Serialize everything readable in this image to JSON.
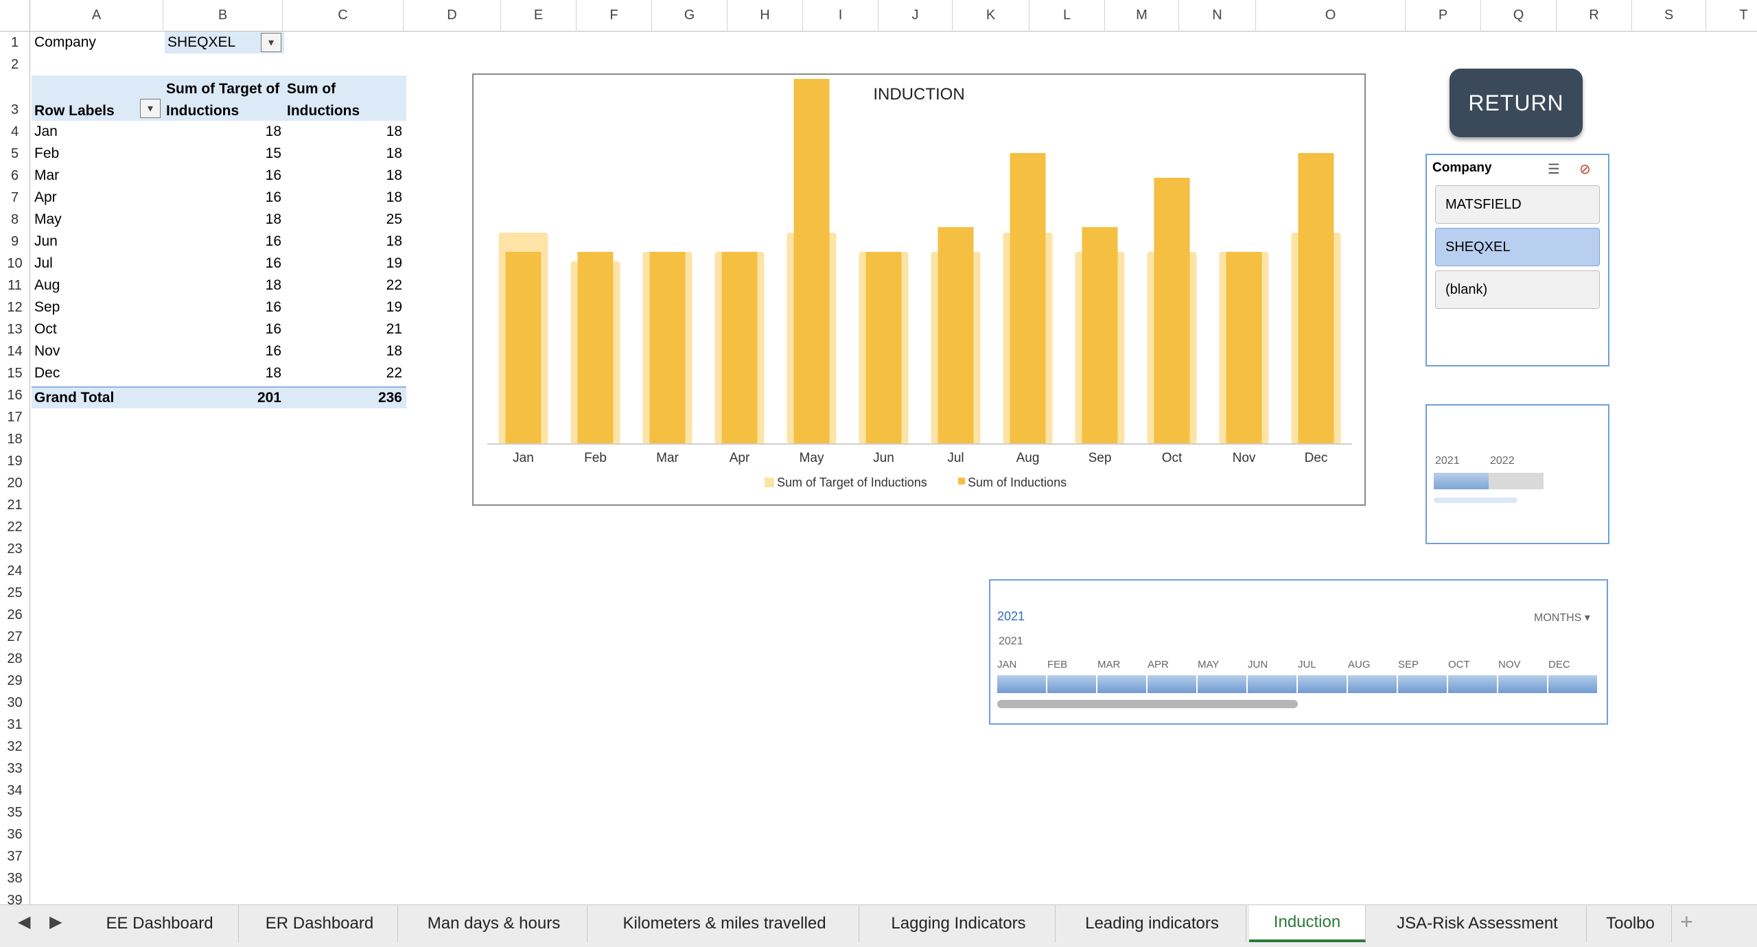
{
  "columns": [
    "A",
    "B",
    "C",
    "D",
    "E",
    "F",
    "G",
    "H",
    "I",
    "J",
    "K",
    "L",
    "M",
    "N",
    "O",
    "P",
    "Q",
    "R",
    "S",
    "T"
  ],
  "rows": [
    "1",
    "2",
    "3",
    "4",
    "5",
    "6",
    "7",
    "8",
    "9",
    "10",
    "11",
    "12",
    "13",
    "14",
    "15",
    "16",
    "17",
    "18",
    "19",
    "20",
    "21",
    "22",
    "23",
    "24",
    "25",
    "26",
    "27",
    "28",
    "29",
    "30",
    "31",
    "32",
    "33",
    "34",
    "35",
    "36",
    "37",
    "38",
    "39"
  ],
  "filter": {
    "label": "Company",
    "value": "SHEQXEL"
  },
  "pivot": {
    "row_labels_header": "Row Labels",
    "col1_header_line1": "Sum of Target of",
    "col1_header_line2": "Inductions",
    "col2_header_line1": "Sum of",
    "col2_header_line2": "Inductions",
    "rows": [
      {
        "label": "Jan",
        "target": "18",
        "actual": "18"
      },
      {
        "label": "Feb",
        "target": "15",
        "actual": "18"
      },
      {
        "label": "Mar",
        "target": "16",
        "actual": "18"
      },
      {
        "label": "Apr",
        "target": "16",
        "actual": "18"
      },
      {
        "label": "May",
        "target": "18",
        "actual": "25"
      },
      {
        "label": "Jun",
        "target": "16",
        "actual": "18"
      },
      {
        "label": "Jul",
        "target": "16",
        "actual": "19"
      },
      {
        "label": "Aug",
        "target": "18",
        "actual": "22"
      },
      {
        "label": "Sep",
        "target": "16",
        "actual": "19"
      },
      {
        "label": "Oct",
        "target": "16",
        "actual": "21"
      },
      {
        "label": "Nov",
        "target": "16",
        "actual": "18"
      },
      {
        "label": "Dec",
        "target": "18",
        "actual": "22"
      }
    ],
    "total_label": "Grand Total",
    "total_target": "201",
    "total_actual": "236"
  },
  "chart_data": {
    "type": "bar",
    "title": "INDUCTION",
    "categories": [
      "Jan",
      "Feb",
      "Mar",
      "Apr",
      "May",
      "Jun",
      "Jul",
      "Aug",
      "Sep",
      "Oct",
      "Nov",
      "Dec"
    ],
    "series": [
      {
        "name": "Sum of Target of Inductions",
        "values": [
          18,
          15,
          16,
          16,
          18,
          16,
          16,
          18,
          16,
          16,
          16,
          18
        ],
        "color": "#fde4a6"
      },
      {
        "name": "Sum of Inductions",
        "values": [
          18,
          18,
          18,
          18,
          25,
          18,
          19,
          22,
          19,
          21,
          18,
          22
        ],
        "color": "#f5bf42"
      }
    ],
    "ylim": [
      0,
      26
    ],
    "grid": false,
    "legend_position": "bottom"
  },
  "return_button": {
    "label": "RETURN"
  },
  "slicer": {
    "title": "Company",
    "items": [
      {
        "label": "MATSFIELD",
        "selected": false
      },
      {
        "label": "SHEQXEL",
        "selected": true
      },
      {
        "label": "(blank)",
        "selected": false
      }
    ]
  },
  "timeline_small": {
    "year1": "2021",
    "year2": "2022"
  },
  "timeline_big": {
    "header_year": "2021",
    "level": "MONTHS",
    "year_label": "2021",
    "months": [
      "JAN",
      "FEB",
      "MAR",
      "APR",
      "MAY",
      "JUN",
      "JUL",
      "AUG",
      "SEP",
      "OCT",
      "NOV",
      "DEC"
    ]
  },
  "tabs": [
    {
      "label": "EE Dashboard",
      "active": false
    },
    {
      "label": "ER Dashboard",
      "active": false
    },
    {
      "label": "Man days & hours",
      "active": false
    },
    {
      "label": "Kilometers & miles travelled",
      "active": false
    },
    {
      "label": "Lagging Indicators",
      "active": false
    },
    {
      "label": "Leading indicators",
      "active": false
    },
    {
      "label": "Induction",
      "active": true
    },
    {
      "label": "JSA-Risk Assessment",
      "active": false
    },
    {
      "label": "Toolbo",
      "active": false
    }
  ],
  "icons": {
    "prev": "prev-sheet-icon",
    "next": "next-sheet-icon",
    "add": "add-sheet-icon",
    "filter": "filter-icon",
    "multiselect": "multiselect-icon",
    "clear_filter": "clear-filter-icon"
  }
}
